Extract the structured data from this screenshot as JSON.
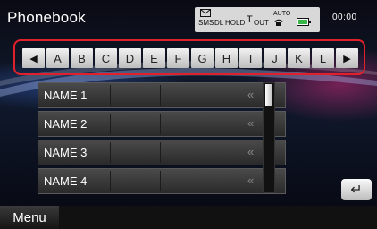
{
  "header": {
    "title": "Phonebook",
    "clock": "00:00"
  },
  "status": {
    "sms": "SMS",
    "dl": "DL",
    "hold": "HOLD",
    "tout": "T",
    "out": "OUT",
    "auto": "AUTO"
  },
  "alphabet": {
    "prev": "◀",
    "next": "▶",
    "letters": [
      "A",
      "B",
      "C",
      "D",
      "E",
      "F",
      "G",
      "H",
      "I",
      "J",
      "K",
      "L"
    ]
  },
  "list": {
    "items": [
      {
        "label": "NAME 1"
      },
      {
        "label": "NAME 2"
      },
      {
        "label": "NAME 3"
      },
      {
        "label": "NAME 4"
      }
    ],
    "chevron": "«"
  },
  "footer": {
    "menu_label": "Menu",
    "back_symbol": "↵"
  },
  "colors": {
    "highlight": "#e0212b",
    "key_bg": "#dcdcdc",
    "row_bg": "#3a3a3a"
  }
}
